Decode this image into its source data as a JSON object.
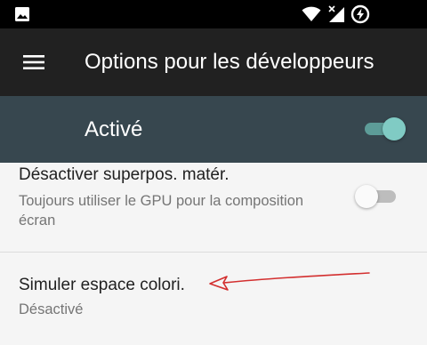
{
  "status_bar": {
    "icons": [
      "image-icon",
      "wifi-icon",
      "no-signal-icon",
      "battery-charging-icon"
    ]
  },
  "app_bar": {
    "title": "Options pour les développeurs",
    "menu_icon": "hamburger-menu-icon"
  },
  "master_switch": {
    "label": "Activé",
    "state": "on",
    "color": "#80cbc4"
  },
  "preferences": [
    {
      "title": "Désactiver superpos. matér.",
      "summary": "Toujours utiliser le GPU pour la composition écran",
      "switch_state": "off"
    },
    {
      "title": "Simuler espace colori.",
      "summary": "Désactivé"
    }
  ],
  "annotation": {
    "type": "arrow",
    "color": "#d32f2f",
    "points_to": "Simuler espace colori."
  }
}
